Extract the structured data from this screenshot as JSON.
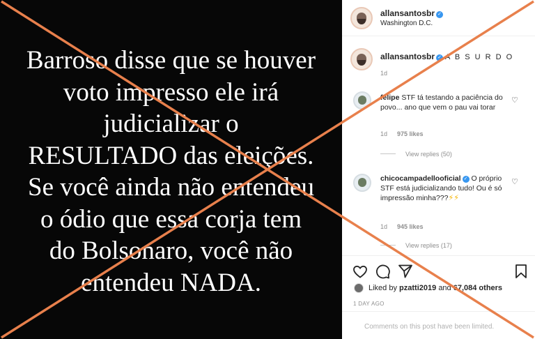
{
  "post_image": {
    "lines": [
      "Barroso disse que se houver",
      "voto impresso ele irá",
      "judicializar o",
      "RESULTADO das eleições.",
      "Se você ainda não entendeu",
      "o ódio que essa corja tem",
      "do Bolsonaro, você não",
      "entendeu NADA."
    ]
  },
  "header": {
    "username": "allansantosbr",
    "location": "Washington D.C."
  },
  "caption": {
    "username": "allansantosbr",
    "text": "A B S U R D O",
    "time": "1d"
  },
  "comments": [
    {
      "username": "felipe",
      "text": "STF tá testando a paciência do povo... ano que vem o pau vai torar",
      "time": "1d",
      "likes": "975 likes",
      "replies": "View replies (50)"
    },
    {
      "username": "chicocampadellooficial",
      "text": "O próprio STF está judicializando tudo! Ou é só impressão minha???",
      "emoji": "⚡⚡",
      "time": "1d",
      "likes": "945 likes",
      "replies": "View replies (17)"
    }
  ],
  "actions": {
    "liked_prefix": "Liked by",
    "liked_user": "pzatti2019",
    "liked_and": "and",
    "liked_count": "67,084 others",
    "posted": "1 DAY AGO",
    "comments_limited": "Comments on this post have been limited."
  },
  "icons": {
    "heart": "heart-icon",
    "comment": "comment-icon",
    "share": "share-icon",
    "bookmark": "bookmark-icon",
    "verified": "verified-badge-icon"
  },
  "colors": {
    "cross": "#e8804c",
    "verified": "#3897f0",
    "muted": "#8e8e8e"
  }
}
